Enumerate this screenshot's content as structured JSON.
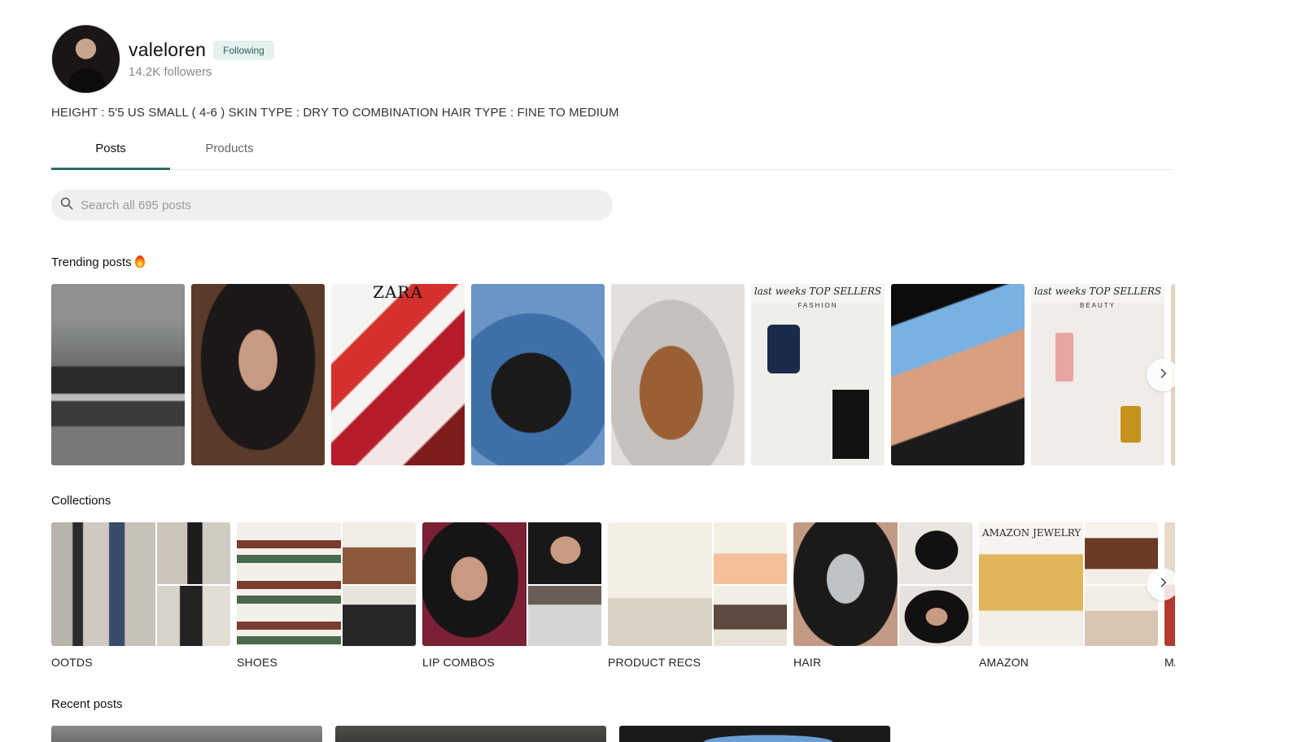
{
  "profile": {
    "username": "valeloren",
    "following_label": "Following",
    "followers": "14.2K followers",
    "bio": "HEIGHT : 5'5 US SMALL ( 4-6 ) SKIN TYPE : DRY TO COMBINATION HAIR TYPE : FINE TO MEDIUM"
  },
  "tabs": [
    {
      "label": "Posts",
      "active": true
    },
    {
      "label": "Products",
      "active": false
    }
  ],
  "search": {
    "placeholder": "Search all 695 posts",
    "icon": "search-icon"
  },
  "trending": {
    "title": "Trending posts",
    "emoji_icon": "fire-icon",
    "post_texts": {
      "p3": "ZARA",
      "p6_title": "last weeks TOP SELLERS",
      "p6_sub": "FASHION",
      "p8_title": "last weeks TOP SELLERS",
      "p8_sub": "BEAUTY"
    },
    "next_icon": "chevron-right-icon"
  },
  "collections": {
    "title": "Collections",
    "items": [
      {
        "label": "OOTDS"
      },
      {
        "label": "SHOES"
      },
      {
        "label": "LIP COMBOS"
      },
      {
        "label": "PRODUCT RECS"
      },
      {
        "label": "HAIR"
      },
      {
        "label": "AMAZON"
      },
      {
        "label": "MA"
      }
    ],
    "image_texts": {
      "amazon": "AMAZON JEWELRY"
    },
    "next_icon": "chevron-right-icon"
  },
  "recent": {
    "title": "Recent posts"
  },
  "colors": {
    "accent": "#2d6a66",
    "badge_bg": "#e3f1ef",
    "badge_text": "#2f5f59",
    "search_bg": "#f0f0f0"
  }
}
